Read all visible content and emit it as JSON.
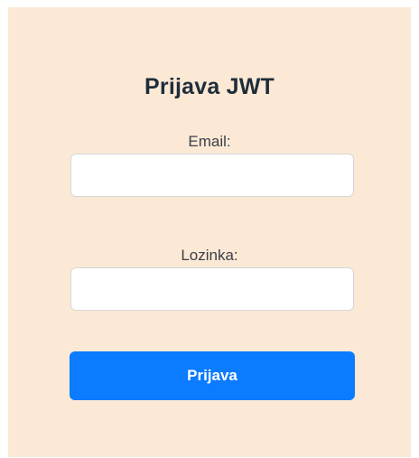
{
  "form": {
    "title": "Prijava JWT",
    "email_label": "Email:",
    "email_value": "",
    "password_label": "Lozinka:",
    "password_value": "",
    "submit_label": "Prijava"
  },
  "colors": {
    "card_background": "#fbe9d6",
    "button_background": "#0b7bff",
    "button_text": "#ffffff",
    "title_text": "#1f2d3a"
  }
}
